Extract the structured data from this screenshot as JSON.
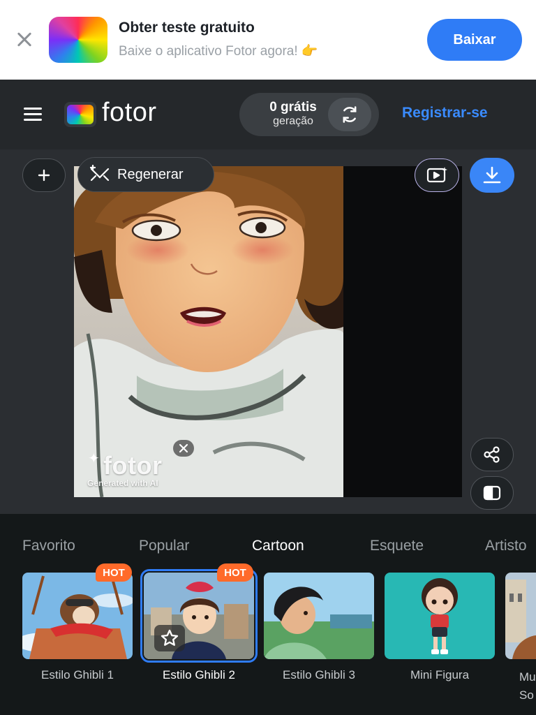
{
  "banner": {
    "title": "Obter teste gratuito",
    "subtitle": "Baixe o aplicativo Fotor agora! 👉",
    "button": "Baixar"
  },
  "header": {
    "logo": "fotor",
    "credits_count": "0 grátis",
    "credits_label": "geração",
    "register": "Registrar-se"
  },
  "toolbar": {
    "regenerate": "Regenerar"
  },
  "watermark": {
    "logo": "fotor",
    "caption": "Generated with AI"
  },
  "tabs": [
    "Favorito",
    "Popular",
    "Cartoon",
    "Esquete",
    "Artisto"
  ],
  "active_tab": "Cartoon",
  "styles": [
    {
      "label": "Estilo Ghibli 1",
      "badge": "HOT"
    },
    {
      "label": "Estilo Ghibli 2",
      "badge": "HOT"
    },
    {
      "label": "Estilo Ghibli 3",
      "badge": ""
    },
    {
      "label": "Mini Figura",
      "badge": ""
    },
    {
      "label": "Mu So",
      "badge": ""
    }
  ],
  "colors": {
    "accent": "#2f7cf6",
    "hot_badge": "#ff6a2a",
    "register_link": "#3a8bff"
  }
}
